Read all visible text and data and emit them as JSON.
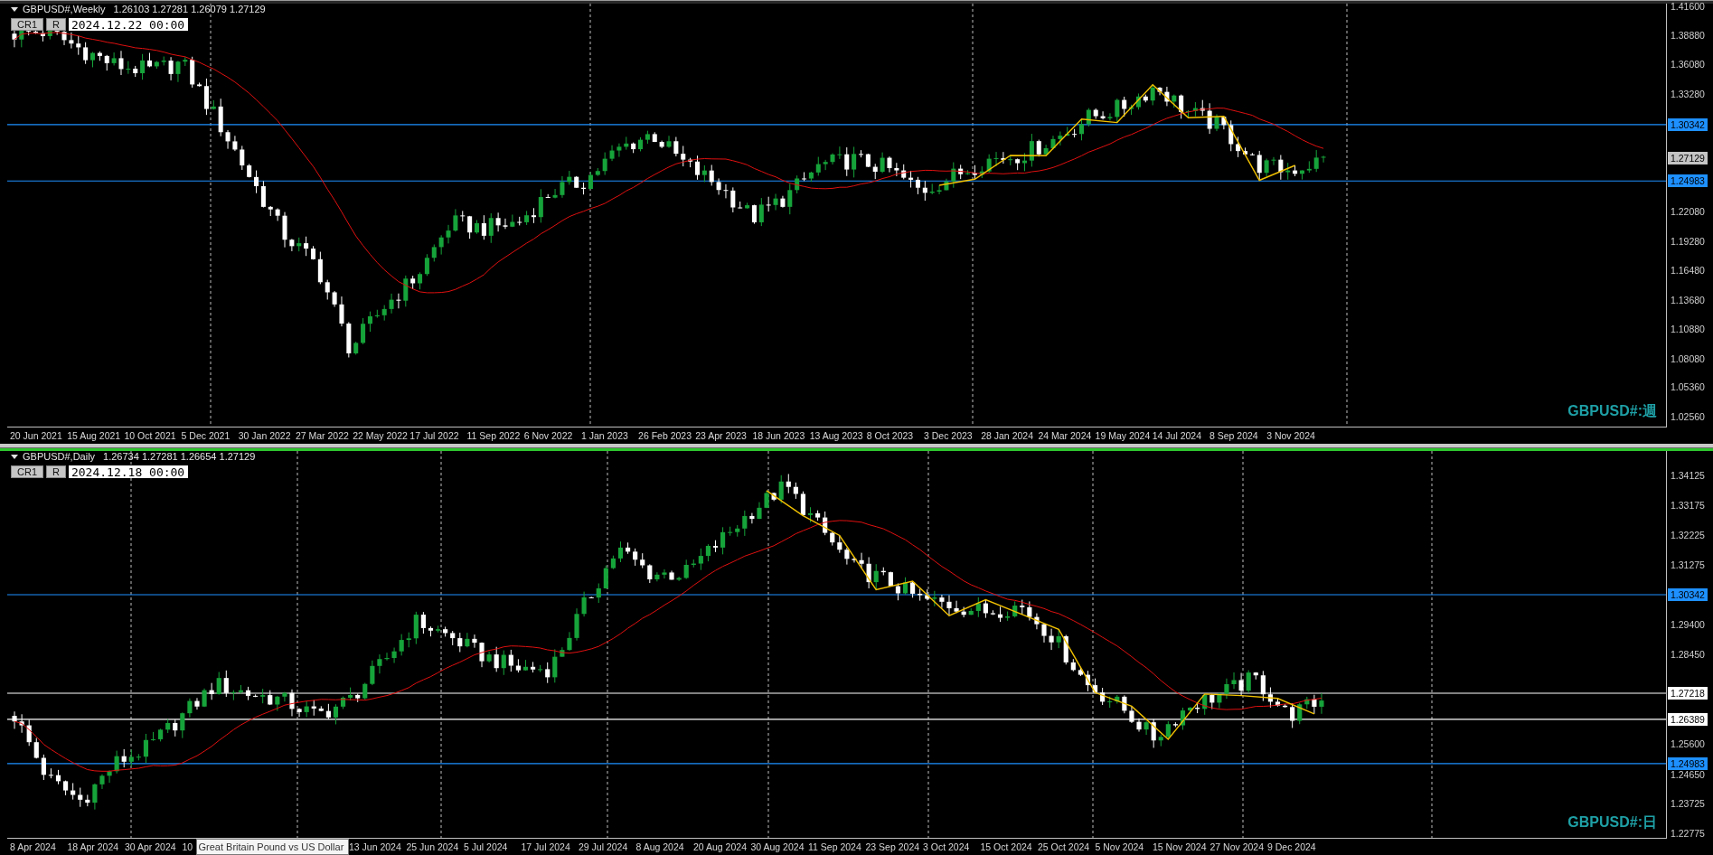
{
  "panels": [
    {
      "selected": false,
      "title": "GBPUSD#,Weekly",
      "ohlc": "1.26103 1.27281 1.26079 1.27129",
      "buttons": [
        "CR1",
        "R"
      ],
      "date_field": "2024.12.22 00:00",
      "symbol_label": "GBPUSD#:週",
      "price_ticks": [
        "1.41600",
        "1.38880",
        "1.36080",
        "1.33280",
        "1.22080",
        "1.19280",
        "1.16480",
        "1.13680",
        "1.10880",
        "1.08080",
        "1.05360",
        "1.02560"
      ],
      "price_lines": [
        {
          "label": "1.30342",
          "color": "#1e90ff"
        },
        {
          "label": "1.24983",
          "color": "#1e90ff"
        }
      ],
      "current_price": "1.27129",
      "axis_items": [
        {
          "kind": "date",
          "text": "20 Jun 2021"
        },
        {
          "kind": "date",
          "text": "15 Aug 2021"
        },
        {
          "kind": "date",
          "text": "10 Oct 2021"
        },
        {
          "kind": "date",
          "text": "5 Dec 2021"
        },
        {
          "kind": "date",
          "text": "30 Jan 2022"
        },
        {
          "kind": "date",
          "text": "27 Mar 2022"
        },
        {
          "kind": "date",
          "text": "22 May 2022"
        },
        {
          "kind": "date",
          "text": "17 Jul 2022"
        },
        {
          "kind": "date",
          "text": "11 Sep 2022"
        },
        {
          "kind": "date",
          "text": "6 Nov 2022"
        },
        {
          "kind": "date",
          "text": "1 Jan 2023"
        },
        {
          "kind": "date",
          "text": "26 Feb 2023"
        },
        {
          "kind": "date",
          "text": "23 Apr 2023"
        },
        {
          "kind": "date",
          "text": "18 Jun 2023"
        },
        {
          "kind": "date",
          "text": "13 Aug 2023"
        },
        {
          "kind": "date",
          "text": "8 Oct 2023"
        },
        {
          "kind": "date",
          "text": "3 Dec 2023"
        },
        {
          "kind": "date",
          "text": "28 Jan 2024"
        },
        {
          "kind": "date",
          "text": "24 Mar 2024"
        },
        {
          "kind": "date",
          "text": "19 May 2024"
        },
        {
          "kind": "date",
          "text": "14 Jul 2024"
        },
        {
          "kind": "date",
          "text": "8 Sep 2024"
        },
        {
          "kind": "date",
          "text": "3 Nov 2024"
        }
      ]
    },
    {
      "selected": true,
      "title": "GBPUSD#,Daily",
      "ohlc": "1.26734 1.27281 1.26654 1.27129",
      "buttons": [
        "CR1",
        "R"
      ],
      "date_field": "2024.12.18 00:00",
      "symbol_label": "GBPUSD#:日",
      "price_ticks": [
        "1.34125",
        "1.33175",
        "1.32225",
        "1.31275",
        "1.29400",
        "1.28450",
        "1.25600",
        "1.24650",
        "1.23725",
        "1.22775"
      ],
      "price_lines": [
        {
          "label": "1.30342",
          "color": "#1e90ff"
        },
        {
          "label": "1.27218",
          "color": "#ffffff"
        },
        {
          "label": "1.26389",
          "color": "#ffffff"
        },
        {
          "label": "1.24983",
          "color": "#1e90ff"
        }
      ],
      "axis_items": [
        {
          "kind": "date",
          "text": "8 Apr 2024"
        },
        {
          "kind": "date",
          "text": "18 Apr 2024"
        },
        {
          "kind": "date",
          "text": "30 Apr 2024"
        },
        {
          "kind": "date",
          "text": "10"
        },
        {
          "kind": "tooltip",
          "text": "Great Britain Pound vs US Dollar"
        },
        {
          "kind": "date",
          "text": "13 Jun 2024"
        },
        {
          "kind": "date",
          "text": "25 Jun 2024"
        },
        {
          "kind": "date",
          "text": "5 Jul 2024"
        },
        {
          "kind": "date",
          "text": "17 Jul 2024"
        },
        {
          "kind": "date",
          "text": "29 Jul 2024"
        },
        {
          "kind": "date",
          "text": "8 Aug 2024"
        },
        {
          "kind": "date",
          "text": "20 Aug 2024"
        },
        {
          "kind": "date",
          "text": "30 Aug 2024"
        },
        {
          "kind": "date",
          "text": "11 Sep 2024"
        },
        {
          "kind": "date",
          "text": "23 Sep 2024"
        },
        {
          "kind": "date",
          "text": "3 Oct 2024"
        },
        {
          "kind": "date",
          "text": "15 Oct 2024"
        },
        {
          "kind": "date",
          "text": "25 Oct 2024"
        },
        {
          "kind": "date",
          "text": "5 Nov 2024"
        },
        {
          "kind": "date",
          "text": "15 Nov 2024"
        },
        {
          "kind": "date",
          "text": "27 Nov 2024"
        },
        {
          "kind": "date",
          "text": "9 Dec 2024"
        }
      ]
    }
  ]
}
